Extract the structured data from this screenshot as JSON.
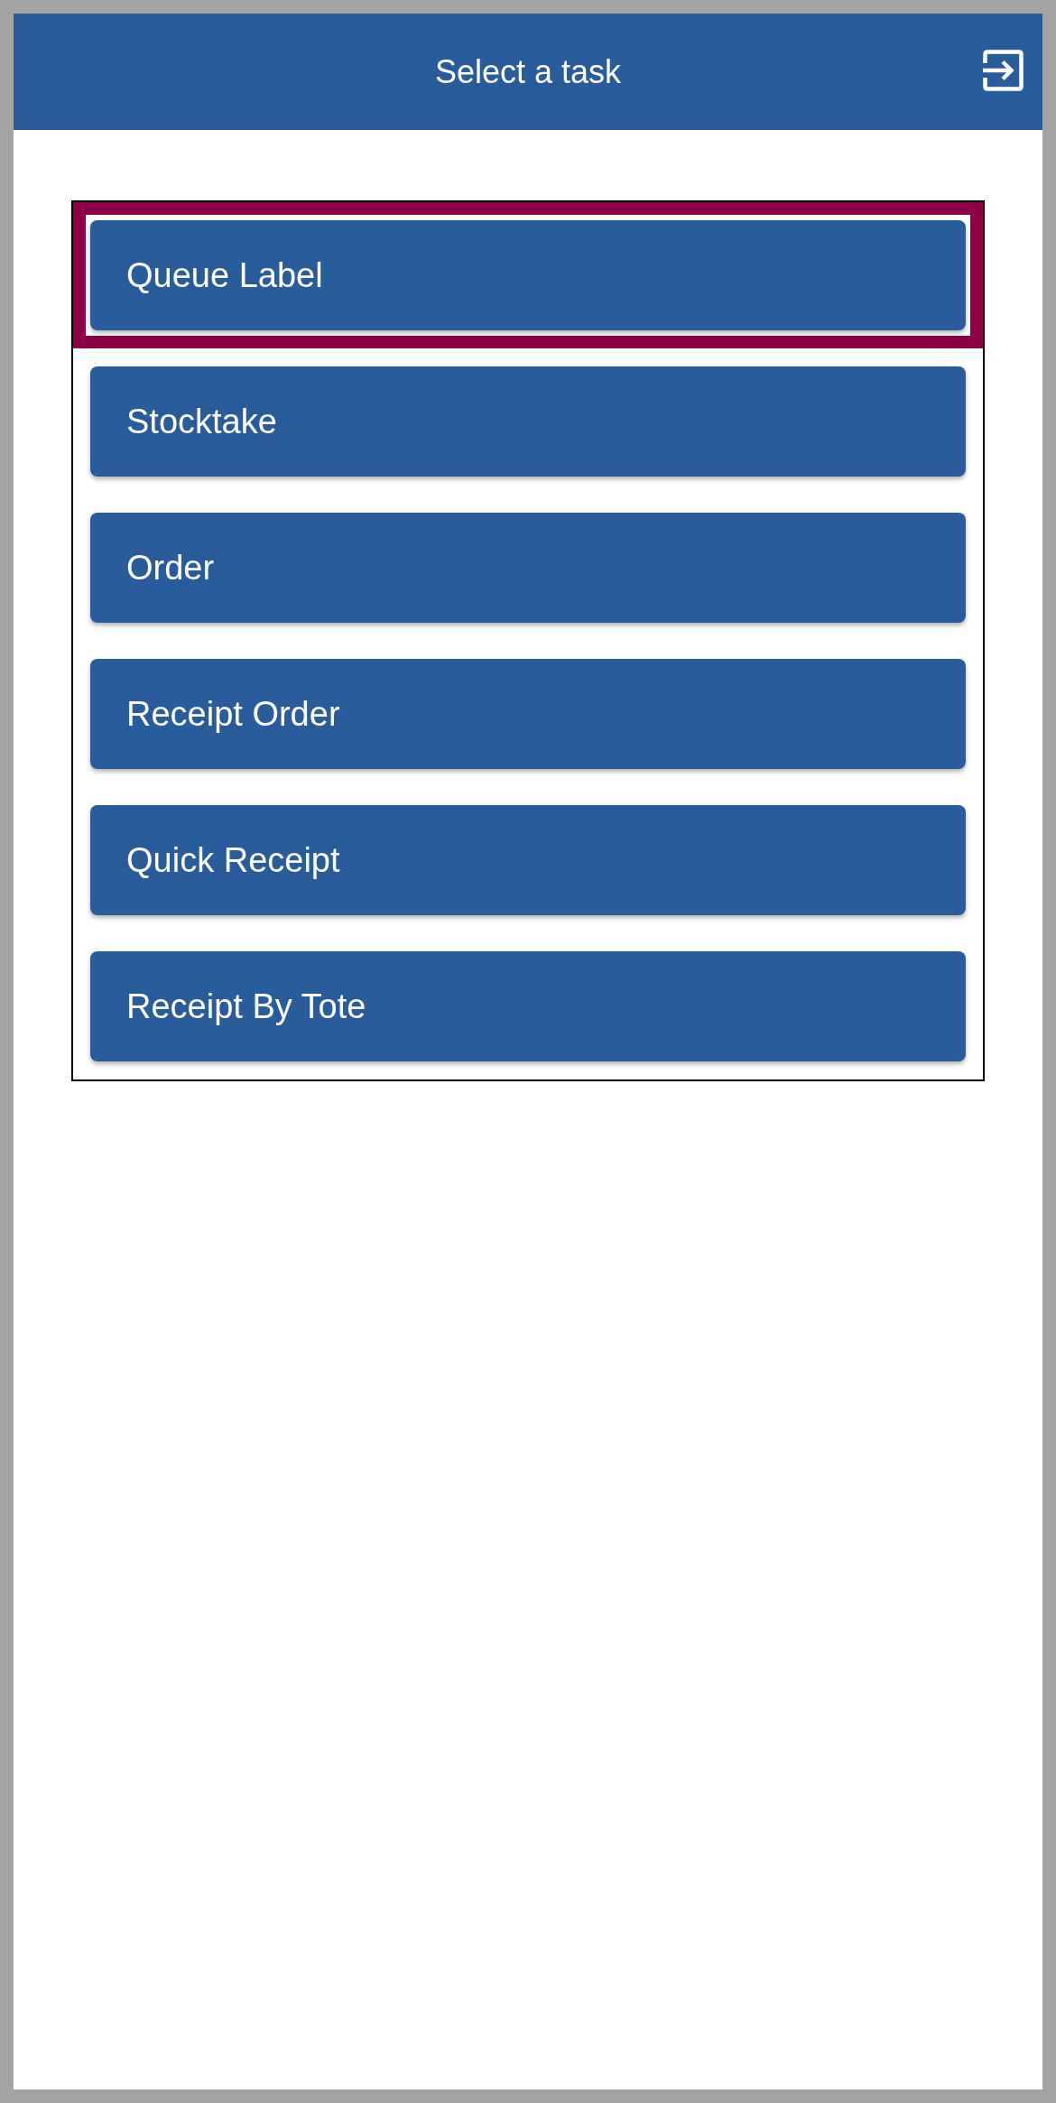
{
  "header": {
    "title": "Select a task"
  },
  "tasks": [
    {
      "label": "Queue Label",
      "selected": true
    },
    {
      "label": "Stocktake",
      "selected": false
    },
    {
      "label": "Order",
      "selected": false
    },
    {
      "label": "Receipt Order",
      "selected": false
    },
    {
      "label": "Quick Receipt",
      "selected": false
    },
    {
      "label": "Receipt By Tote",
      "selected": false
    }
  ]
}
